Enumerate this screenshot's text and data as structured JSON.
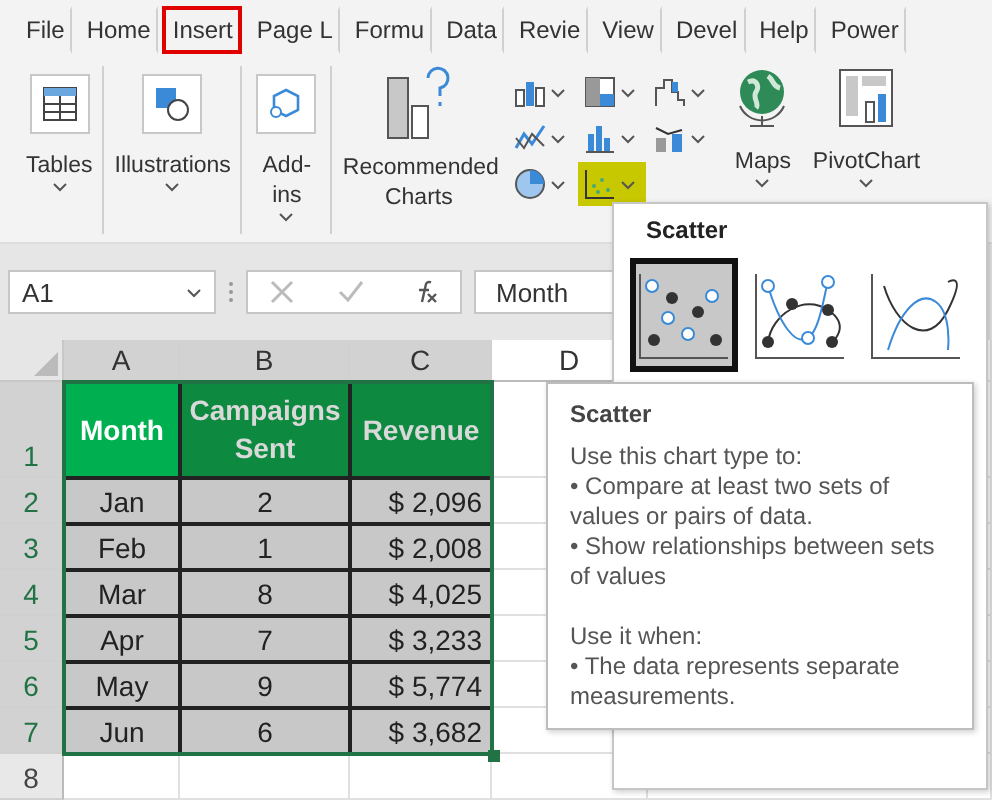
{
  "ribbon_tabs": [
    {
      "label": "File",
      "selected": false
    },
    {
      "label": "Home",
      "selected": false
    },
    {
      "label": "Insert",
      "selected": true
    },
    {
      "label": "Page L",
      "selected": false
    },
    {
      "label": "Formu",
      "selected": false
    },
    {
      "label": "Data",
      "selected": false
    },
    {
      "label": "Revie",
      "selected": false
    },
    {
      "label": "View",
      "selected": false
    },
    {
      "label": "Devel",
      "selected": false
    },
    {
      "label": "Help",
      "selected": false
    },
    {
      "label": "Power",
      "selected": false
    }
  ],
  "ribbon_groups": [
    {
      "kind": "tables",
      "label": "Tables"
    },
    {
      "kind": "illustrations",
      "label": "Illustrations"
    },
    {
      "kind": "addins",
      "label": "Add-ins"
    }
  ],
  "recommended": {
    "label": "Recommended Charts"
  },
  "chart_buttons": [
    {
      "kind": "column",
      "selected": false
    },
    {
      "kind": "line",
      "selected": false
    },
    {
      "kind": "pie",
      "selected": false
    },
    {
      "kind": "hierarchy",
      "selected": false
    },
    {
      "kind": "statistic",
      "selected": false
    },
    {
      "kind": "scatter",
      "selected": true
    },
    {
      "kind": "waterfall",
      "selected": false
    },
    {
      "kind": "combo",
      "selected": false
    }
  ],
  "maps": {
    "label": "Maps"
  },
  "pivot_chart": {
    "label": "PivotChart"
  },
  "formula_bar": {
    "name_box": "A1",
    "value": "Month"
  },
  "column_headers": [
    "A",
    "B",
    "C",
    "D"
  ],
  "row_headers": [
    "1",
    "2",
    "3",
    "4",
    "5",
    "6",
    "7",
    "8"
  ],
  "table": {
    "headers": [
      {
        "text": "Month",
        "selected": true
      },
      {
        "text": "Campaigns Sent",
        "selected": false
      },
      {
        "text": "Revenue",
        "selected": false
      }
    ],
    "rows": [
      [
        "Jan",
        "2",
        "$ 2,096"
      ],
      [
        "Feb",
        "1",
        "$ 2,008"
      ],
      [
        "Mar",
        "8",
        "$ 4,025"
      ],
      [
        "Apr",
        "7",
        "$ 3,233"
      ],
      [
        "May",
        "9",
        "$ 5,774"
      ],
      [
        "Jun",
        "6",
        "$ 3,682"
      ]
    ]
  },
  "scatter_menu": {
    "title": "Scatter",
    "options": [
      {
        "kind": "markers",
        "selected": true
      },
      {
        "kind": "smooth_markers",
        "selected": false
      },
      {
        "kind": "smooth",
        "selected": false
      }
    ]
  },
  "tooltip": {
    "title": "Scatter",
    "paragraphs": [
      "Use this chart type to:\n• Compare at least two sets of values or pairs of data.\n• Show relationships between sets of values",
      "Use it when:\n• The data represents separate measurements."
    ]
  }
}
